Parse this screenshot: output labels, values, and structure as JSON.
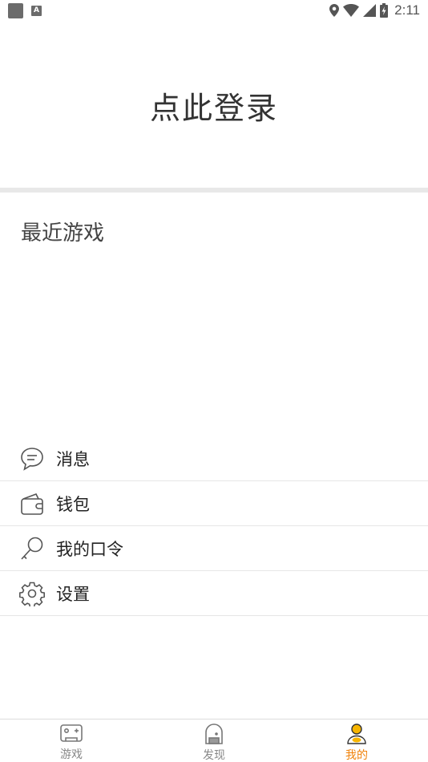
{
  "status_bar": {
    "time": "2:11",
    "icons": [
      "notification-square-icon",
      "a-icon",
      "location-icon",
      "wifi-icon",
      "signal-icon",
      "battery-charging-icon"
    ]
  },
  "login": {
    "label": "点此登录"
  },
  "recent_games": {
    "title": "最近游戏"
  },
  "menu": {
    "items": [
      {
        "label": "消息",
        "icon": "message-bubble-icon"
      },
      {
        "label": "钱包",
        "icon": "wallet-icon"
      },
      {
        "label": "我的口令",
        "icon": "key-icon"
      },
      {
        "label": "设置",
        "icon": "gear-icon"
      }
    ]
  },
  "tabbar": {
    "active_color": "#f0820a",
    "tabs": [
      {
        "label": "游戏",
        "icon": "gamepad-icon",
        "active": false
      },
      {
        "label": "发现",
        "icon": "discover-icon",
        "active": false
      },
      {
        "label": "我的",
        "icon": "user-icon",
        "active": true
      }
    ]
  }
}
